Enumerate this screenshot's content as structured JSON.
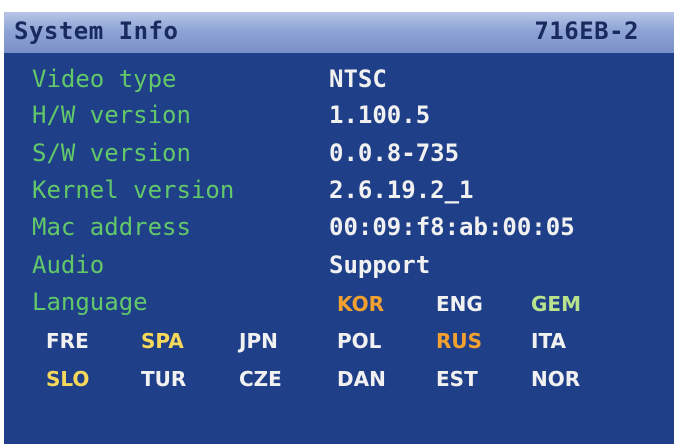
{
  "header": {
    "title": "System Info",
    "model": "716EB-2"
  },
  "info": [
    {
      "label": "Video type",
      "value": "NTSC"
    },
    {
      "label": "H/W version",
      "value": "1.100.5"
    },
    {
      "label": "S/W version",
      "value": "0.0.8-735"
    },
    {
      "label": "Kernel version",
      "value": "2.6.19.2_1"
    },
    {
      "label": "Mac address",
      "value": "00:09:f8:ab:00:05"
    },
    {
      "label": "Audio",
      "value": "Support"
    }
  ],
  "language": {
    "label": "Language",
    "options": [
      {
        "code": "KOR",
        "color": "#f2a030"
      },
      {
        "code": "ENG",
        "color": "#f1f1f1"
      },
      {
        "code": "GEM",
        "color": "#b9e28c"
      },
      {
        "code": "FRE",
        "color": "#f1f1f1"
      },
      {
        "code": "SPA",
        "color": "#f6d95a"
      },
      {
        "code": "JPN",
        "color": "#f1f1f1"
      },
      {
        "code": "POL",
        "color": "#f1f1f1"
      },
      {
        "code": "RUS",
        "color": "#f2a030"
      },
      {
        "code": "ITA",
        "color": "#f1f1f1"
      },
      {
        "code": "SLO",
        "color": "#f6d95a"
      },
      {
        "code": "TUR",
        "color": "#f1f1f1"
      },
      {
        "code": "CZE",
        "color": "#f1f1f1"
      },
      {
        "code": "DAN",
        "color": "#f1f1f1"
      },
      {
        "code": "EST",
        "color": "#f1f1f1"
      },
      {
        "code": "NOR",
        "color": "#f1f1f1"
      }
    ]
  },
  "colors": {
    "background": "#1f3f88",
    "label": "#62c86a",
    "value": "#f1f1f1"
  }
}
